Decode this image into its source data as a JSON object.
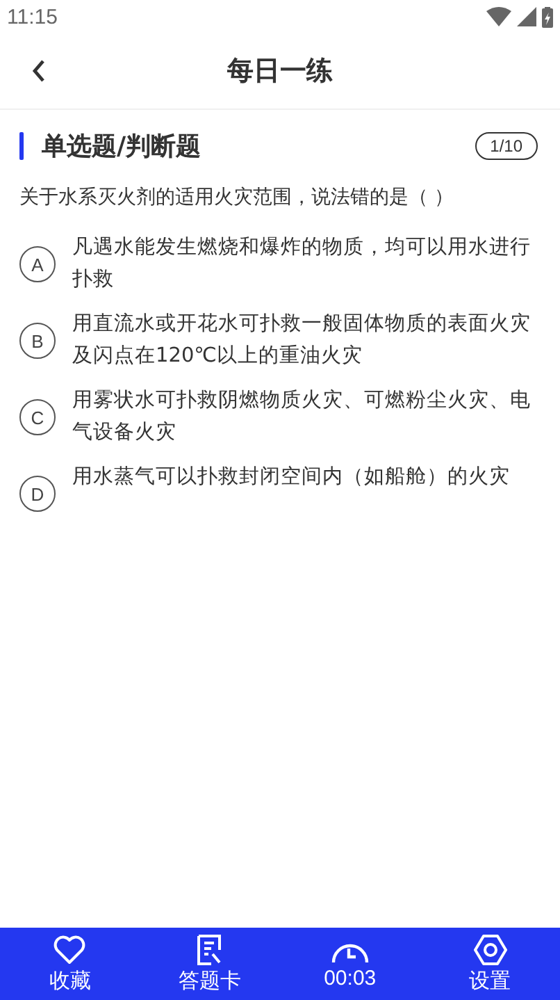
{
  "status_bar": {
    "time": "11:15"
  },
  "header": {
    "title": "每日一练"
  },
  "section": {
    "title": "单选题/判断题",
    "progress": "1/10"
  },
  "question": "关于水系灭火剂的适用火灾范围，说法错的是（ ）",
  "options": [
    {
      "letter": "A",
      "text": "凡遇水能发生燃烧和爆炸的物质，均可以用水进行扑救"
    },
    {
      "letter": "B",
      "text": "用直流水或开花水可扑救一般固体物质的表面火灾及闪点在120℃以上的重油火灾"
    },
    {
      "letter": "C",
      "text": "用雾状水可扑救阴燃物质火灾、可燃粉尘火灾、电气设备火灾"
    },
    {
      "letter": "D",
      "text": "用水蒸气可以扑救封闭空间内（如船舱）的火灾"
    }
  ],
  "bottom_bar": [
    {
      "kind": "favorite",
      "label": "收藏"
    },
    {
      "kind": "card",
      "label": "答题卡"
    },
    {
      "kind": "timer",
      "label": "00:03"
    },
    {
      "kind": "settings",
      "label": "设置"
    }
  ]
}
